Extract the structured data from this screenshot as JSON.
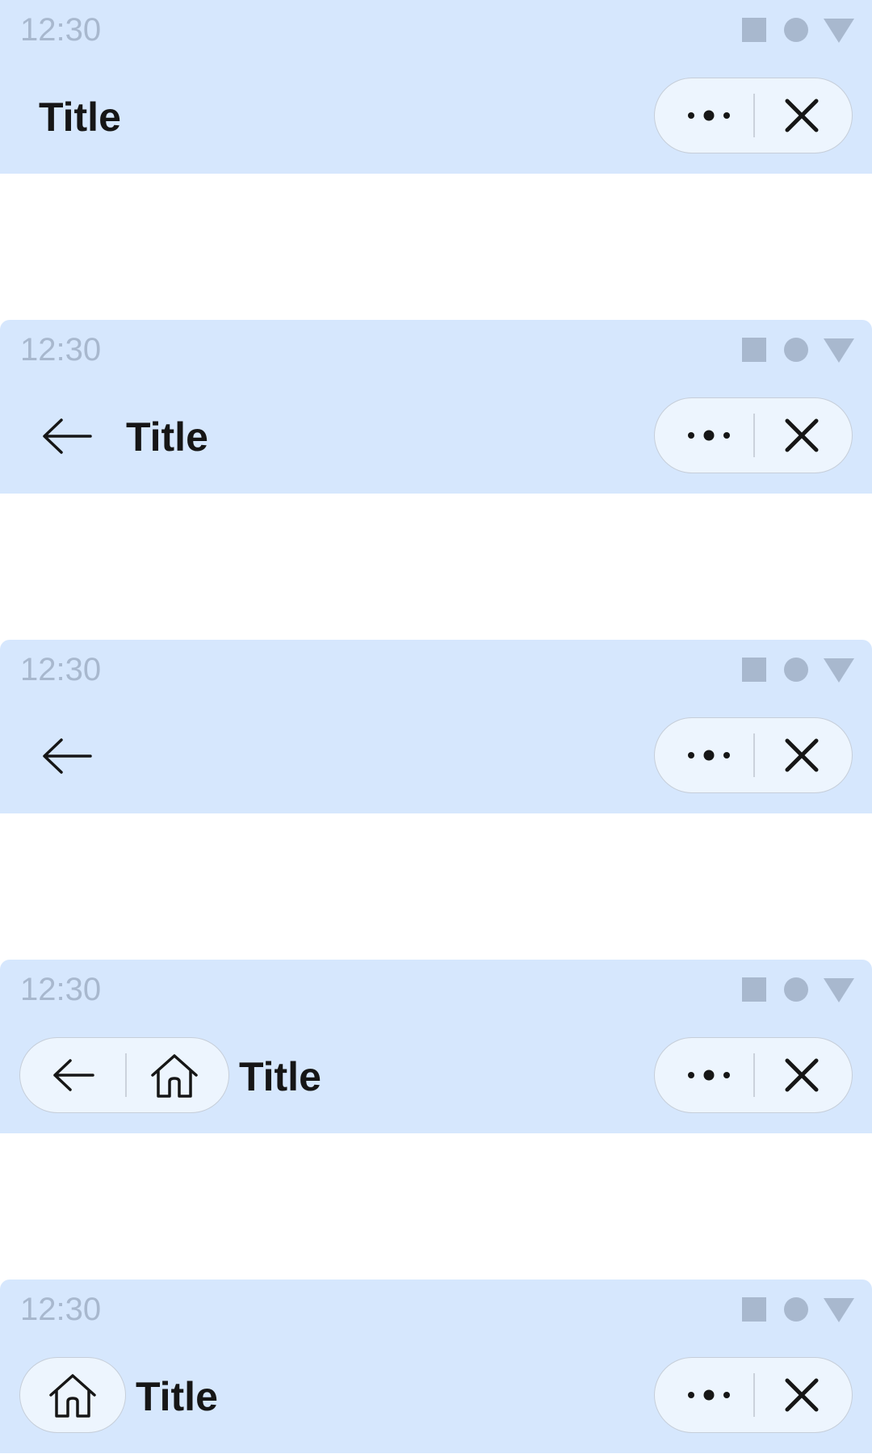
{
  "colors": {
    "header_background": "#d6e7fd",
    "capsule_background": "#edf5fe",
    "capsule_border": "#c6ced9",
    "status_gray": "#a8b8ce",
    "title_text": "#161616"
  },
  "icons": {
    "back": "arrow-left-icon",
    "home": "home-icon",
    "more": "more-dots-icon",
    "close": "close-icon",
    "status": [
      "square-icon",
      "circle-icon",
      "triangle-icon"
    ]
  },
  "variants": [
    {
      "status_time": "12:30",
      "title": "Title"
    },
    {
      "status_time": "12:30",
      "title": "Title"
    },
    {
      "status_time": "12:30"
    },
    {
      "status_time": "12:30",
      "title": "Title"
    },
    {
      "status_time": "12:30",
      "title": "Title"
    }
  ]
}
